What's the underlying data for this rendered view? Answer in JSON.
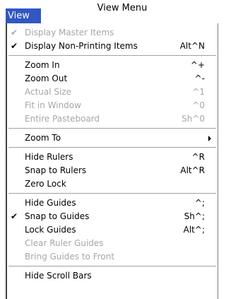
{
  "caption": "View Menu",
  "menu_title": "View",
  "menu": {
    "display_master_items": {
      "label": "Display Master Items",
      "shortcut": "",
      "checked": true,
      "enabled": false
    },
    "display_non_printing": {
      "label": "Display Non-Printing Items",
      "shortcut": "Alt^N",
      "checked": true,
      "enabled": true
    },
    "zoom_in": {
      "label": "Zoom In",
      "shortcut": "^+",
      "checked": false,
      "enabled": true
    },
    "zoom_out": {
      "label": "Zoom Out",
      "shortcut": "^-",
      "checked": false,
      "enabled": true
    },
    "actual_size": {
      "label": "Actual Size",
      "shortcut": "^1",
      "checked": false,
      "enabled": false
    },
    "fit_in_window": {
      "label": "Fit in Window",
      "shortcut": "^0",
      "checked": false,
      "enabled": false
    },
    "entire_pasteboard": {
      "label": "Entire Pasteboard",
      "shortcut": "Sh^0",
      "checked": false,
      "enabled": false
    },
    "zoom_to": {
      "label": "Zoom To",
      "submenu": true
    },
    "hide_rulers": {
      "label": "Hide Rulers",
      "shortcut": "^R",
      "checked": false,
      "enabled": true
    },
    "snap_to_rulers": {
      "label": "Snap to Rulers",
      "shortcut": "Alt^R",
      "checked": false,
      "enabled": true
    },
    "zero_lock": {
      "label": "Zero Lock",
      "shortcut": "",
      "checked": false,
      "enabled": true
    },
    "hide_guides": {
      "label": "Hide Guides",
      "shortcut": "^;",
      "checked": false,
      "enabled": true
    },
    "snap_to_guides": {
      "label": "Snap to Guides",
      "shortcut": "Sh^;",
      "checked": true,
      "enabled": true
    },
    "lock_guides": {
      "label": "Lock Guides",
      "shortcut": "Alt^;",
      "checked": false,
      "enabled": true
    },
    "clear_ruler_guides": {
      "label": "Clear Ruler Guides",
      "shortcut": "",
      "checked": false,
      "enabled": false
    },
    "bring_guides_front": {
      "label": "Bring Guides to Front",
      "shortcut": "",
      "checked": false,
      "enabled": false
    },
    "hide_scroll_bars": {
      "label": "Hide Scroll Bars",
      "shortcut": "",
      "checked": false,
      "enabled": true
    }
  },
  "check_glyph": "✔",
  "icons": {
    "check": "checkmark-icon",
    "submenu": "submenu-arrow-icon"
  },
  "colors": {
    "menu_tab_bg": "#3157c1",
    "disabled_text": "#a6a6a6",
    "separator": "#a0a0a0"
  }
}
